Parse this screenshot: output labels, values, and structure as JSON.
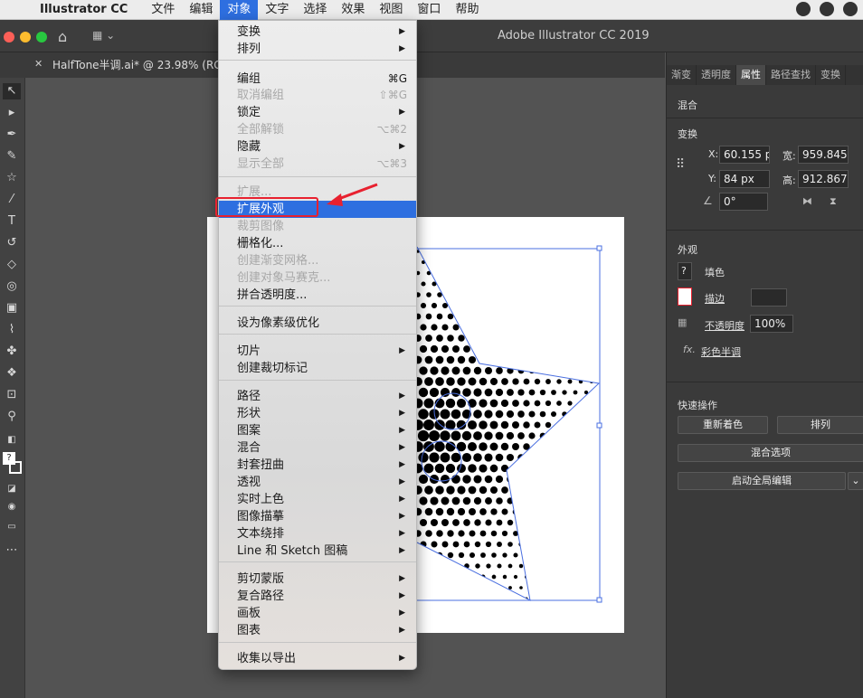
{
  "menubar": {
    "app": "Illustrator CC",
    "items": [
      "文件",
      "编辑",
      "对象",
      "文字",
      "选择",
      "效果",
      "视图",
      "窗口",
      "帮助"
    ]
  },
  "window": {
    "title": "Adobe Illustrator CC 2019"
  },
  "document": {
    "tab": "HalfTone半调.ai* @ 23.98% (RGB/预..."
  },
  "menu": {
    "items": [
      {
        "label": "变换",
        "arrow": "▶"
      },
      {
        "label": "排列",
        "arrow": "▶"
      },
      {
        "label": "编组",
        "shortcut": "⌘G"
      },
      {
        "label": "取消编组",
        "shortcut": "⇧⌘G",
        "disabled": true
      },
      {
        "label": "锁定",
        "arrow": "▶"
      },
      {
        "label": "全部解锁",
        "shortcut": "⌥⌘2",
        "disabled": true
      },
      {
        "label": "隐藏",
        "arrow": "▶"
      },
      {
        "label": "显示全部",
        "shortcut": "⌥⌘3",
        "disabled": true
      },
      {
        "label": "扩展...",
        "disabled": true
      },
      {
        "label": "扩展外观",
        "selected": true
      },
      {
        "label": "裁剪图像",
        "disabled": true
      },
      {
        "label": "栅格化..."
      },
      {
        "label": "创建渐变网格...",
        "disabled": true
      },
      {
        "label": "创建对象马赛克...",
        "disabled": true
      },
      {
        "label": "拼合透明度..."
      },
      {
        "label": "设为像素级优化"
      },
      {
        "label": "切片",
        "arrow": "▶"
      },
      {
        "label": "创建裁切标记"
      },
      {
        "label": "路径",
        "arrow": "▶"
      },
      {
        "label": "形状",
        "arrow": "▶"
      },
      {
        "label": "图案",
        "arrow": "▶"
      },
      {
        "label": "混合",
        "arrow": "▶"
      },
      {
        "label": "封套扭曲",
        "arrow": "▶"
      },
      {
        "label": "透视",
        "arrow": "▶"
      },
      {
        "label": "实时上色",
        "arrow": "▶"
      },
      {
        "label": "图像描摹",
        "arrow": "▶"
      },
      {
        "label": "文本绕排",
        "arrow": "▶"
      },
      {
        "label": "Line 和 Sketch 图稿",
        "arrow": "▶"
      },
      {
        "label": "剪切蒙版",
        "arrow": "▶"
      },
      {
        "label": "复合路径",
        "arrow": "▶"
      },
      {
        "label": "画板",
        "arrow": "▶"
      },
      {
        "label": "图表",
        "arrow": "▶"
      },
      {
        "label": "收集以导出",
        "arrow": "▶"
      }
    ]
  },
  "panel": {
    "tabs": [
      "渐变",
      "透明度",
      "属性",
      "路径查找",
      "变换"
    ],
    "active_tab": "属性",
    "blend_label": "混合",
    "transform_label": "变换",
    "x_label": "X:",
    "x_value": "60.155 p",
    "y_label": "Y:",
    "y_value": "84 px",
    "w_label": "宽:",
    "w_value": "959.845",
    "h_label": "高:",
    "h_value": "912.867",
    "angle_value": "0°",
    "appearance_label": "外观",
    "fill_label": "填色",
    "stroke_label": "描边",
    "opacity_label": "不透明度",
    "opacity_value": "100%",
    "fx_label": "fx.",
    "effect_label": "彩色半调",
    "quick_label": "快速操作",
    "recolor_btn": "重新着色",
    "arrange_btn": "排列",
    "blend_options_btn": "混合选项",
    "global_edit_btn": "启动全局编辑"
  },
  "colors": {
    "accent": "#2e6fe0",
    "highlight_red": "#e8212f",
    "selection_blue": "#4a6fe0"
  }
}
